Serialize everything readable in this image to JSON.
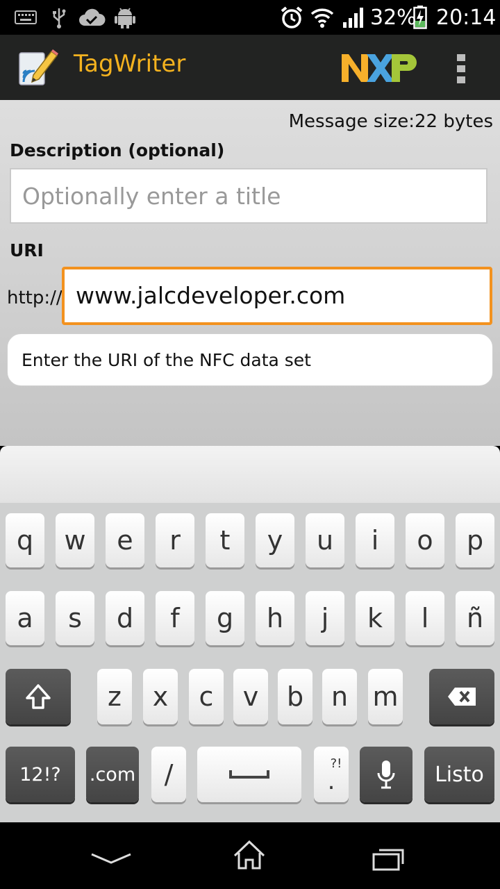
{
  "status_bar": {
    "battery_percent": "32%",
    "time": "20:14",
    "icons": [
      "keyboard-icon",
      "usb-icon",
      "cloud-check-icon",
      "android-icon",
      "alarm-icon",
      "wifi-icon",
      "signal-icon",
      "battery-charging-icon"
    ]
  },
  "action_bar": {
    "title": "TagWriter",
    "brand": "NXP",
    "icons": [
      "app-logo-icon",
      "nxp-logo",
      "overflow-menu-icon"
    ]
  },
  "form": {
    "message_size": "Message size:22 bytes",
    "description_label": "Description (optional)",
    "description_placeholder": "Optionally enter a title",
    "uri_label": "URI",
    "uri_prefix": "http://",
    "uri_value": "www.jalcdeveloper.com",
    "hint": "Enter the URI of the NFC data set"
  },
  "keyboard": {
    "row1": [
      "q",
      "w",
      "e",
      "r",
      "t",
      "y",
      "u",
      "i",
      "o",
      "p"
    ],
    "row2": [
      "a",
      "s",
      "d",
      "f",
      "g",
      "h",
      "j",
      "k",
      "l",
      "ñ"
    ],
    "row3": [
      "z",
      "x",
      "c",
      "v",
      "b",
      "n",
      "m"
    ],
    "symbols_label": "12!?",
    "dotcom_label": ".com",
    "slash_label": "/",
    "period_label": ".",
    "period_alt": "?!",
    "done_label": "Listo"
  },
  "colors": {
    "accent": "#f3921f",
    "title": "#f4b21f",
    "actionbar": "#222322"
  }
}
